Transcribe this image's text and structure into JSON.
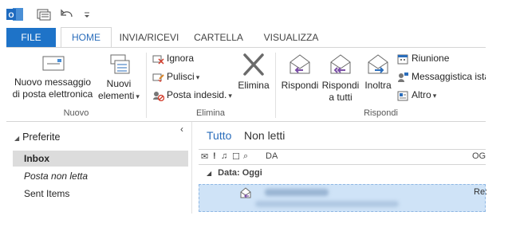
{
  "tabs": {
    "file": "FILE",
    "home": "HOME",
    "send_receive": "INVIA/RICEVI",
    "folder": "CARTELLA",
    "view": "VISUALIZZA"
  },
  "ribbon": {
    "nuovo": {
      "group_label": "Nuovo",
      "new_email_line1": "Nuovo messaggio",
      "new_email_line2": "di posta elettronica",
      "new_items_line1": "Nuovi",
      "new_items_line2": "elementi"
    },
    "elimina": {
      "group_label": "Elimina",
      "ignore": "Ignora",
      "clean_up": "Pulisci",
      "junk": "Posta indesid.",
      "delete": "Elimina"
    },
    "rispondi": {
      "group_label": "Rispondi",
      "reply": "Rispondi",
      "reply_all_line1": "Rispondi",
      "reply_all_line2": "a tutti",
      "forward": "Inoltra",
      "meeting": "Riunione",
      "im": "Messaggistica ista",
      "more": "Altro"
    }
  },
  "nav": {
    "favorites": "Preferite",
    "items": [
      {
        "label": "Inbox"
      },
      {
        "label": "Posta non letta"
      },
      {
        "label": "Sent Items"
      }
    ],
    "collapse_glyph": "‹"
  },
  "mail": {
    "filter_all": "Tutto",
    "filter_unread": "Non letti",
    "columns": {
      "from": "DA",
      "subject": "OG"
    },
    "group_header": "Data: Oggi",
    "row": {
      "subject_fragment": "Re:"
    }
  },
  "colors": {
    "accent": "#1e73c8",
    "selected_row": "#cfe3f7"
  }
}
